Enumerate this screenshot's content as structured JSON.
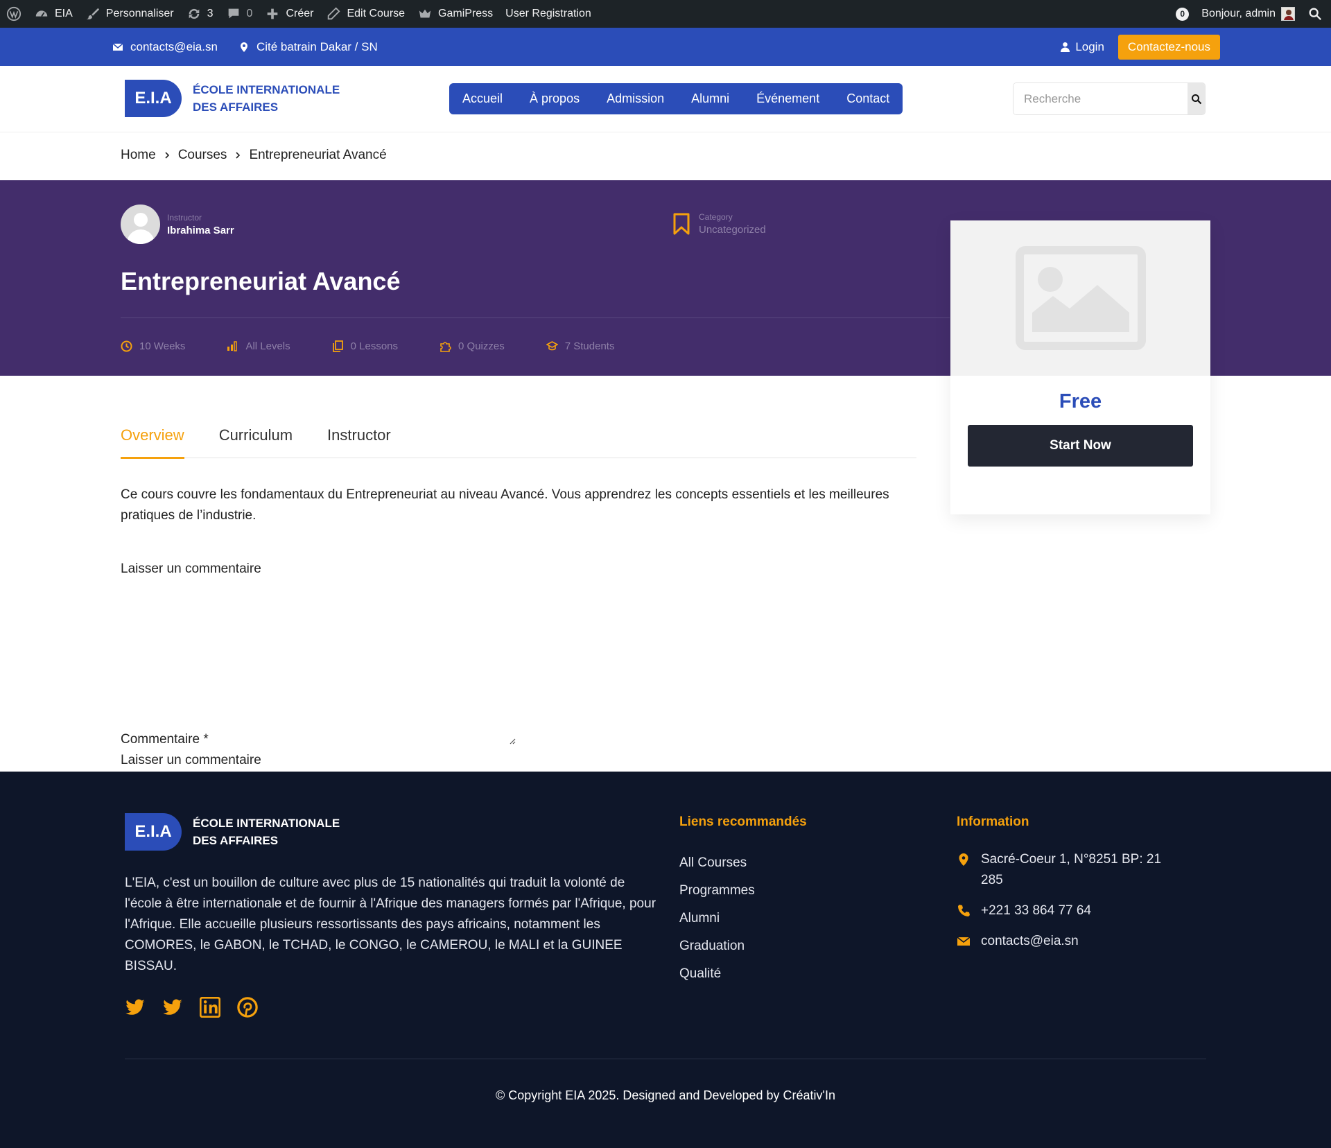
{
  "colors": {
    "admin_bar": "#1d2327",
    "primary": "#2b4db8",
    "accent": "#f5a10d",
    "hero": "#432d6b",
    "footer": "#0e1629",
    "button_dark": "#232733"
  },
  "admin_bar": {
    "items": [
      {
        "icon": "wordpress-icon",
        "label": ""
      },
      {
        "icon": "dashboard-icon",
        "label": "EIA"
      },
      {
        "icon": "brush-icon",
        "label": "Personnaliser"
      },
      {
        "icon": "updates-icon",
        "label": "3"
      },
      {
        "icon": "comments-icon",
        "label": "0"
      },
      {
        "icon": "plus-icon",
        "label": "Créer"
      },
      {
        "icon": "pencil-icon",
        "label": "Edit Course"
      },
      {
        "icon": "crown-icon",
        "label": "GamiPress"
      },
      {
        "icon": "",
        "label": "User Registration"
      }
    ],
    "notification_count": "0",
    "greeting": "Bonjour, admin"
  },
  "topbar": {
    "email": "contacts@eia.sn",
    "location": "Cité batrain Dakar / SN",
    "login": "Login",
    "contact_button": "Contactez-nous"
  },
  "header": {
    "logo_badge": "E.I.A",
    "logo_line1": "ÉCOLE INTERNATIONALE",
    "logo_line2": "DES AFFAIRES",
    "nav": [
      "Accueil",
      "À propos",
      "Admission",
      "Alumni",
      "Événement",
      "Contact"
    ],
    "search_placeholder": "Recherche"
  },
  "breadcrumb": [
    "Home",
    "Courses",
    "Entrepreneuriat Avancé"
  ],
  "course": {
    "instructor_label": "Instructor",
    "instructor_name": "Ibrahima Sarr",
    "category_label": "Category",
    "category_value": "Uncategorized",
    "title": "Entrepreneuriat Avancé",
    "stats": [
      {
        "icon": "clock-icon",
        "label": "10 Weeks"
      },
      {
        "icon": "levels-icon",
        "label": "All Levels"
      },
      {
        "icon": "lessons-icon",
        "label": "0 Lessons"
      },
      {
        "icon": "puzzle-icon",
        "label": "0 Quizzes"
      },
      {
        "icon": "graduation-icon",
        "label": "7 Students"
      }
    ],
    "price": "Free",
    "start_button": "Start Now",
    "tabs": [
      "Overview",
      "Curriculum",
      "Instructor"
    ],
    "description": "Ce cours couvre les fondamentaux du Entrepreneuriat au niveau Avancé. Vous apprendrez les concepts essentiels et les meilleures pratiques de l’industrie.",
    "comment_title": "Laisser un commentaire",
    "comment_label": "Commentaire *",
    "comment_placeholder": "Laisser un commentaire"
  },
  "footer": {
    "logo_badge": "E.I.A",
    "logo_line1": "ÉCOLE INTERNATIONALE",
    "logo_line2": "DES AFFAIRES",
    "about": "L'EIA, c'est un bouillon de culture avec plus de 15 nationalités qui traduit la volonté de l'école à être internationale et de fournir à l'Afrique des managers formés par l'Afrique, pour l'Afrique. Elle accueille plusieurs ressortissants des pays africains, notamment les COMORES, le GABON, le TCHAD, le CONGO, le CAMEROU, le MALI et la GUINEE BISSAU.",
    "links_title": "Liens recommandés",
    "links": [
      "All Courses",
      "Programmes",
      "Alumni",
      "Graduation",
      "Qualité"
    ],
    "info_title": "Information",
    "address": "Sacré-Coeur 1, N°8251 BP: 21 285",
    "phone": "+221 33 864 77 64",
    "email": "contacts@eia.sn",
    "socials": [
      "twitter-icon",
      "twitter-icon",
      "linkedin-icon",
      "pinterest-icon"
    ],
    "copyright": "© Copyright EIA 2025. Designed and Developed by Créativ'In"
  }
}
